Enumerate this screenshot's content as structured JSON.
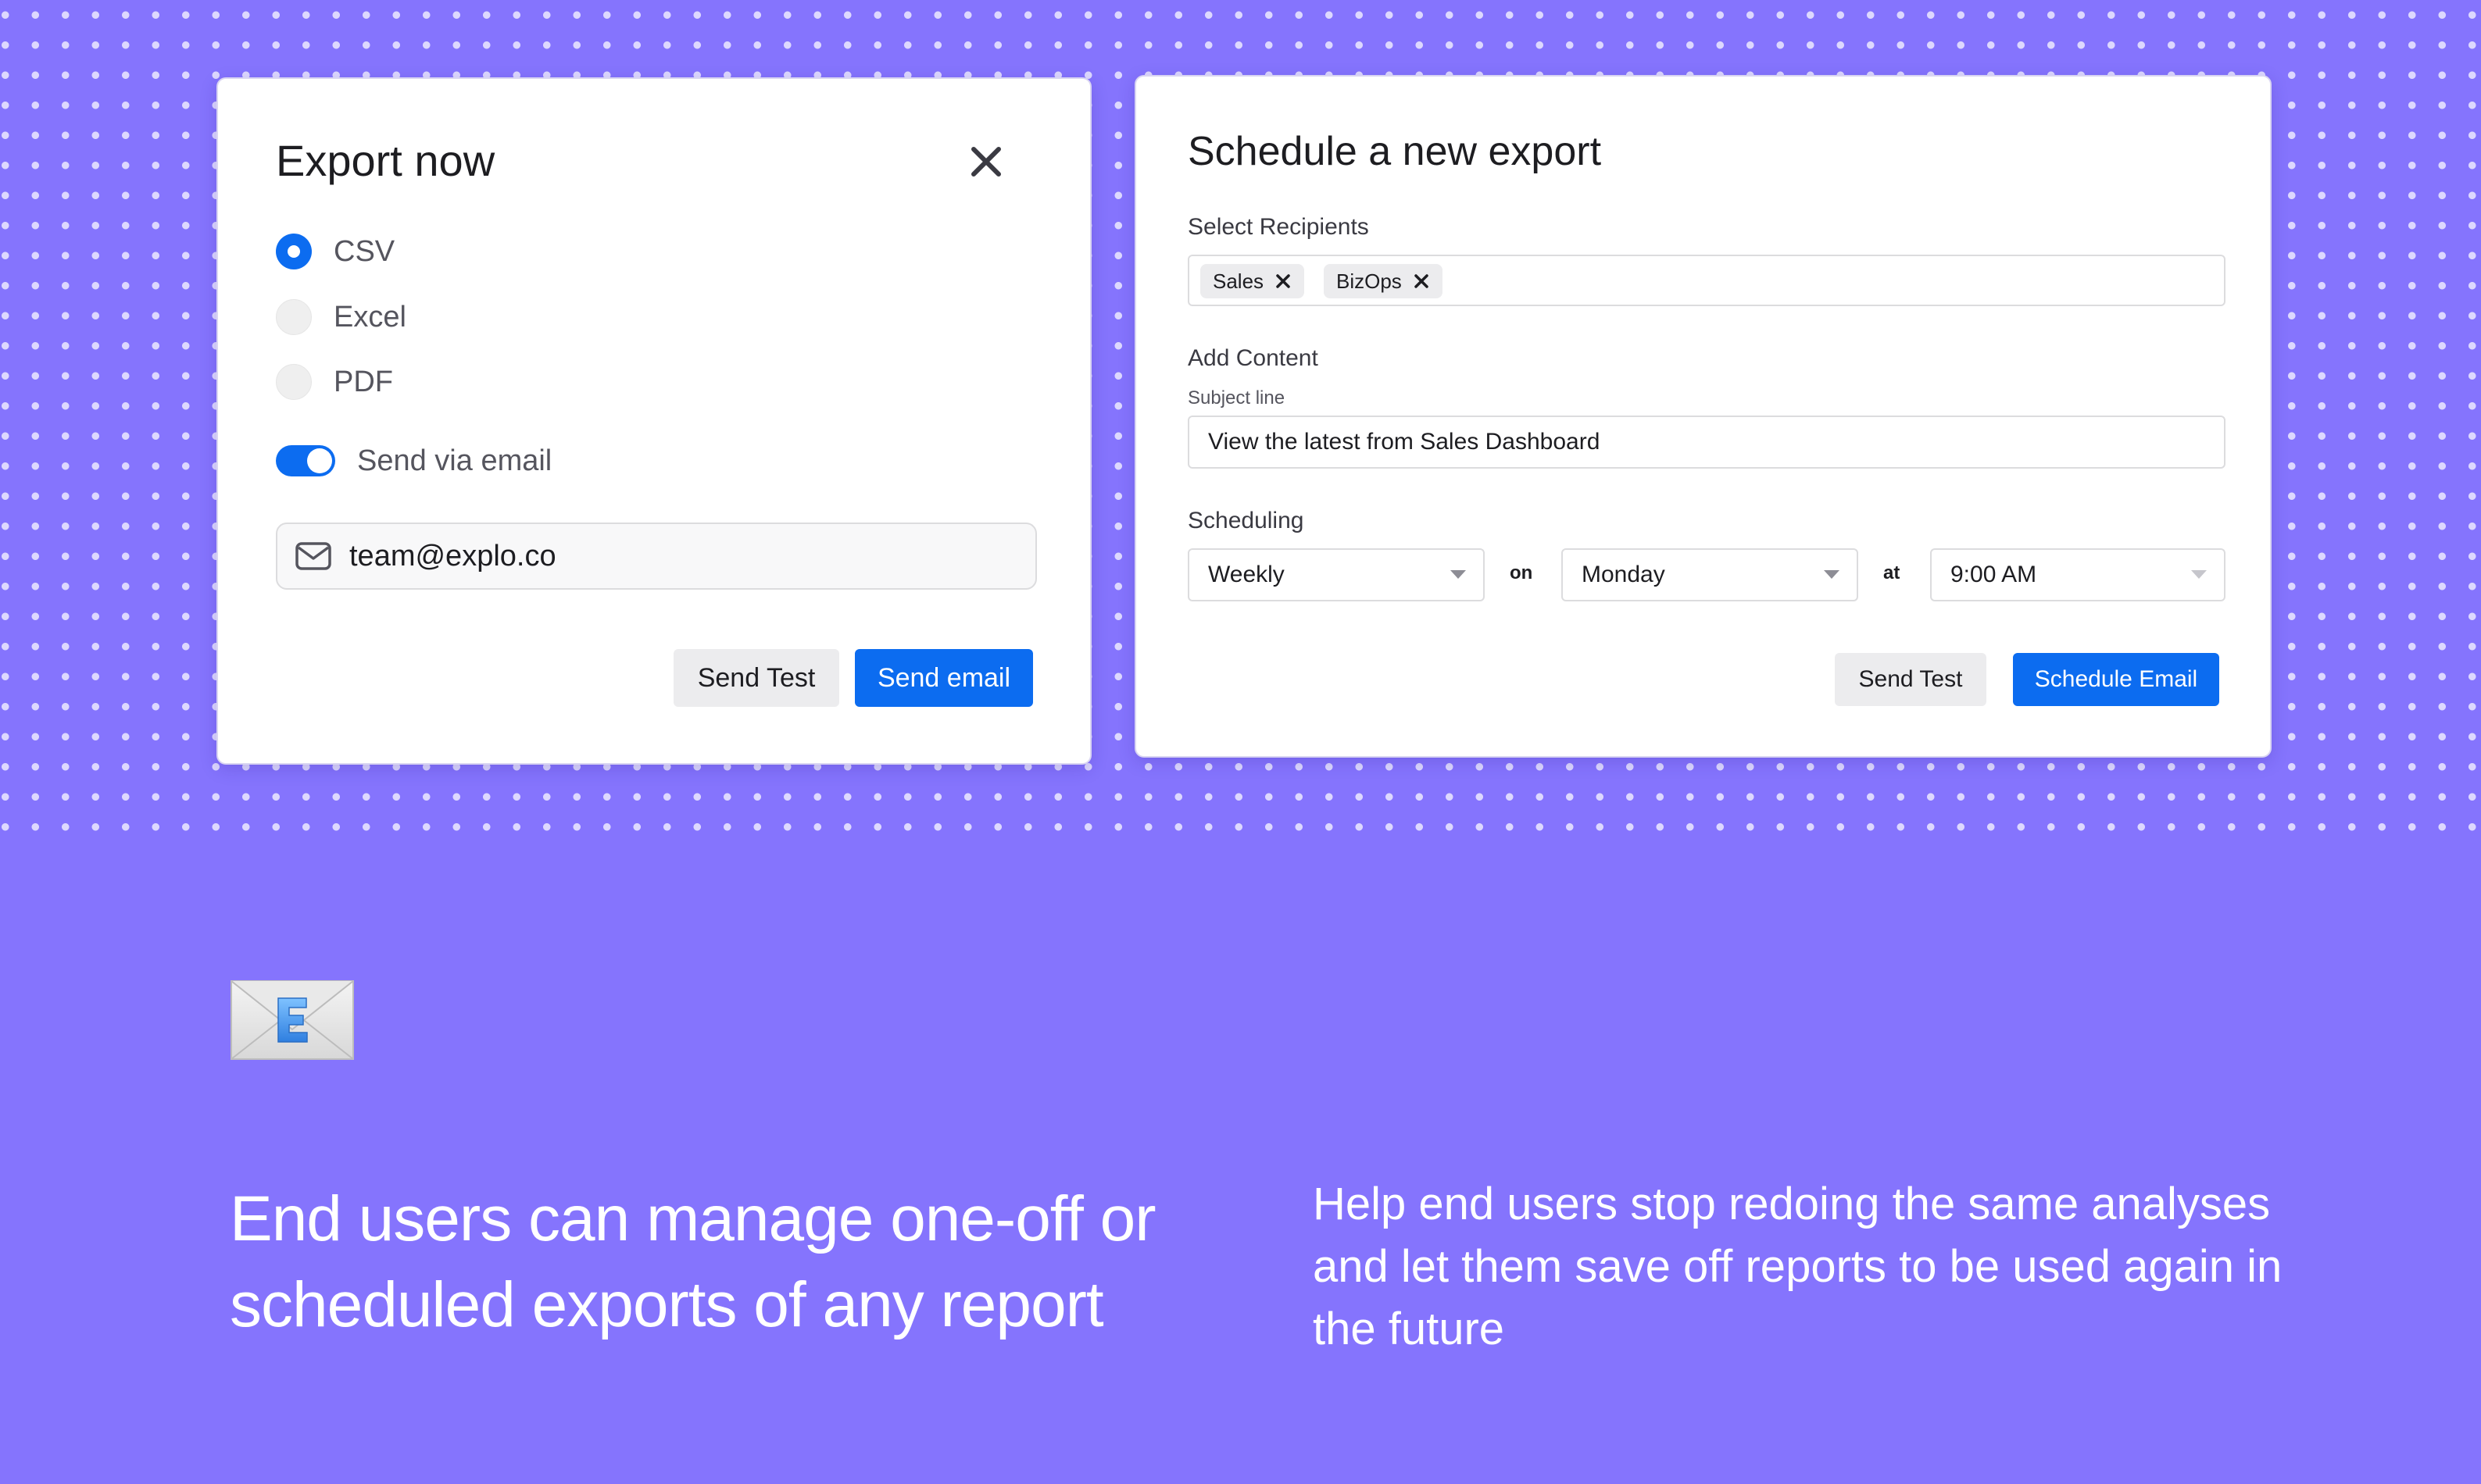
{
  "export_now": {
    "title": "Export now",
    "formats": [
      {
        "label": "CSV",
        "selected": true
      },
      {
        "label": "Excel",
        "selected": false
      },
      {
        "label": "PDF",
        "selected": false
      }
    ],
    "send_via_email": {
      "label": "Send via email",
      "enabled": true
    },
    "email": {
      "value": "team@explo.co",
      "icon": "mail-icon"
    },
    "send_test_label": "Send Test",
    "send_email_label": "Send email"
  },
  "schedule": {
    "title": "Schedule a new export",
    "recipients_label": "Select Recipients",
    "recipients": [
      "Sales",
      "BizOps"
    ],
    "content_label": "Add Content",
    "subject_label": "Subject line",
    "subject_value": "View the latest from Sales Dashboard",
    "scheduling_label": "Scheduling",
    "frequency": "Weekly",
    "on_label": "on",
    "day": "Monday",
    "at_label": "at",
    "time": "9:00 AM",
    "send_test_label": "Send Test",
    "schedule_email_label": "Schedule Email"
  },
  "marketing": {
    "headline": "End users can manage one-off or scheduled exports of any report",
    "description": "Help end users stop redoing the same analyses and let them save off reports to be used again in the future",
    "icon": "envelope-icon"
  },
  "colors": {
    "background": "#8574fd",
    "accent": "#0c6cf0"
  }
}
